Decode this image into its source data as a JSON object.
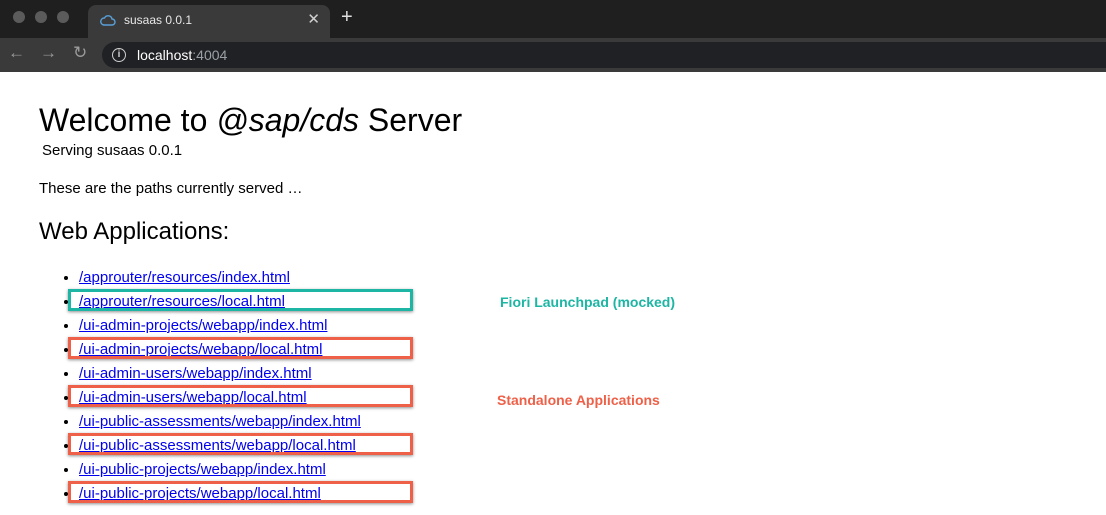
{
  "browser": {
    "tab_title": "susaas 0.0.1",
    "close_glyph": "✕",
    "new_tab_glyph": "+",
    "back_glyph": "←",
    "forward_glyph": "→",
    "reload_glyph": "↻",
    "info_glyph": "i",
    "url_host": "localhost",
    "url_port": ":4004"
  },
  "page": {
    "title_prefix": "Welcome to ",
    "title_em": "@sap/cds",
    "title_suffix": " Server",
    "serving": "Serving susaas 0.0.1",
    "paths_intro": "These are the paths currently served …",
    "webapps_heading": "Web Applications:",
    "links": [
      "/approuter/resources/index.html",
      "/approuter/resources/local.html",
      "/ui-admin-projects/webapp/index.html",
      "/ui-admin-projects/webapp/local.html",
      "/ui-admin-users/webapp/index.html",
      "/ui-admin-users/webapp/local.html",
      "/ui-public-assessments/webapp/index.html",
      "/ui-public-assessments/webapp/local.html",
      "/ui-public-projects/webapp/index.html",
      "/ui-public-projects/webapp/local.html"
    ]
  },
  "annotations": {
    "fiori_label": "Fiori Launchpad (mocked)",
    "standalone_label": "Standalone Applications",
    "fiori_color": "#1db5a3",
    "standalone_color": "#ee6048"
  }
}
